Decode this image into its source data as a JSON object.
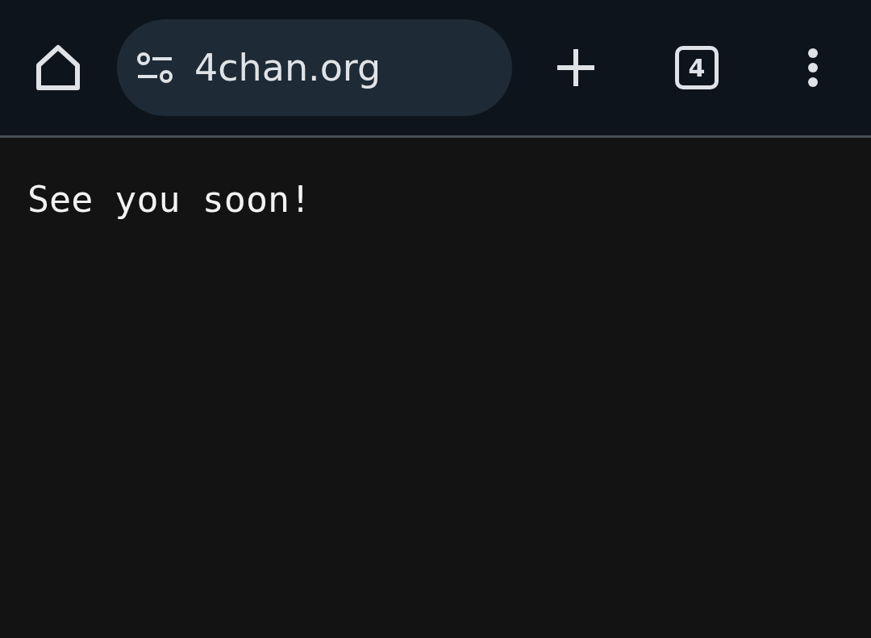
{
  "toolbar": {
    "url": "4chan.org",
    "tab_count": "4"
  },
  "page": {
    "message": "See you soon!"
  }
}
